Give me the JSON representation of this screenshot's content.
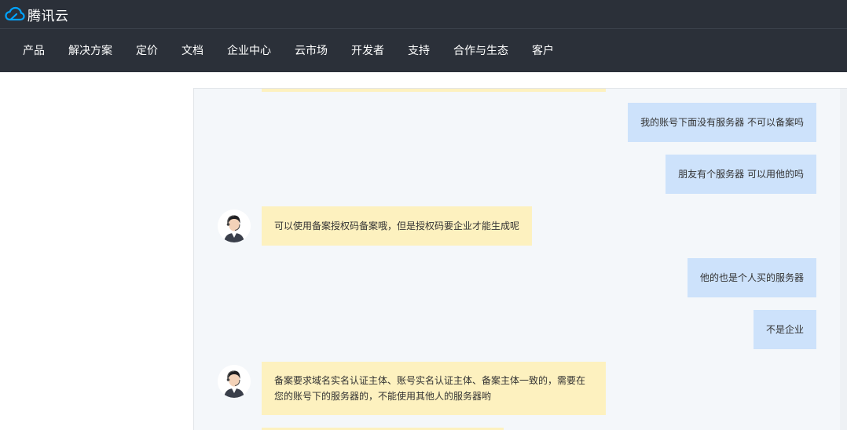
{
  "header": {
    "brand": "腾讯云",
    "brand_color": "#00a4ff",
    "bg_color": "#2b3039"
  },
  "nav": {
    "items": [
      "产品",
      "解决方案",
      "定价",
      "文档",
      "企业中心",
      "云市场",
      "开发者",
      "支持",
      "合作与生态",
      "客户"
    ]
  },
  "chat": {
    "user_bubble_color": "#cde2fb",
    "agent_bubble_color": "#fdf1bf",
    "messages": [
      {
        "sender": "user",
        "text": "我的账号下面没有服务器 不可以备案吗"
      },
      {
        "sender": "user",
        "text": "朋友有个服务器 可以用他的吗"
      },
      {
        "sender": "agent",
        "text": "可以使用备案授权码备案哦，但是授权码要企业才能生成呢"
      },
      {
        "sender": "user",
        "text": "他的也是个人买的服务器"
      },
      {
        "sender": "user",
        "text": "不是企业"
      },
      {
        "sender": "agent",
        "text": "备案要求域名实名认证主体、账号实名认证主体、备案主体一致的，需要在您的账号下的服务器的，不能使用其他人的服务器哟"
      }
    ]
  }
}
